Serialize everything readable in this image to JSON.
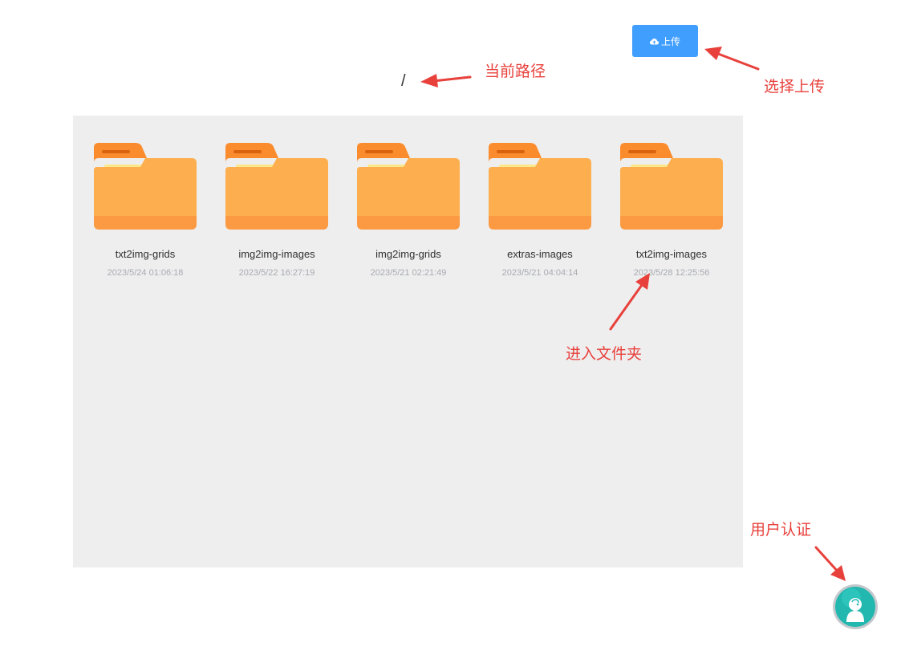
{
  "toolbar": {
    "upload_label": "上传",
    "upload_icon": "cloud-upload-icon",
    "accent_color": "#409eff"
  },
  "path": {
    "current": "/"
  },
  "folders": [
    {
      "name": "txt2img-grids",
      "date": "2023/5/24 01:06:18"
    },
    {
      "name": "img2img-images",
      "date": "2023/5/22 16:27:19"
    },
    {
      "name": "img2img-grids",
      "date": "2023/5/21 02:21:49"
    },
    {
      "name": "extras-images",
      "date": "2023/5/21 04:04:14"
    },
    {
      "name": "txt2img-images",
      "date": "2023/5/28 12:25:56"
    }
  ],
  "annotations": {
    "current_path": "当前路径",
    "select_upload": "选择上传",
    "enter_folder": "进入文件夹",
    "user_auth": "用户认证",
    "color": "#e8413c"
  },
  "user": {
    "avatar_icon": "user-avatar-icon",
    "avatar_color": "#22b8b0"
  }
}
